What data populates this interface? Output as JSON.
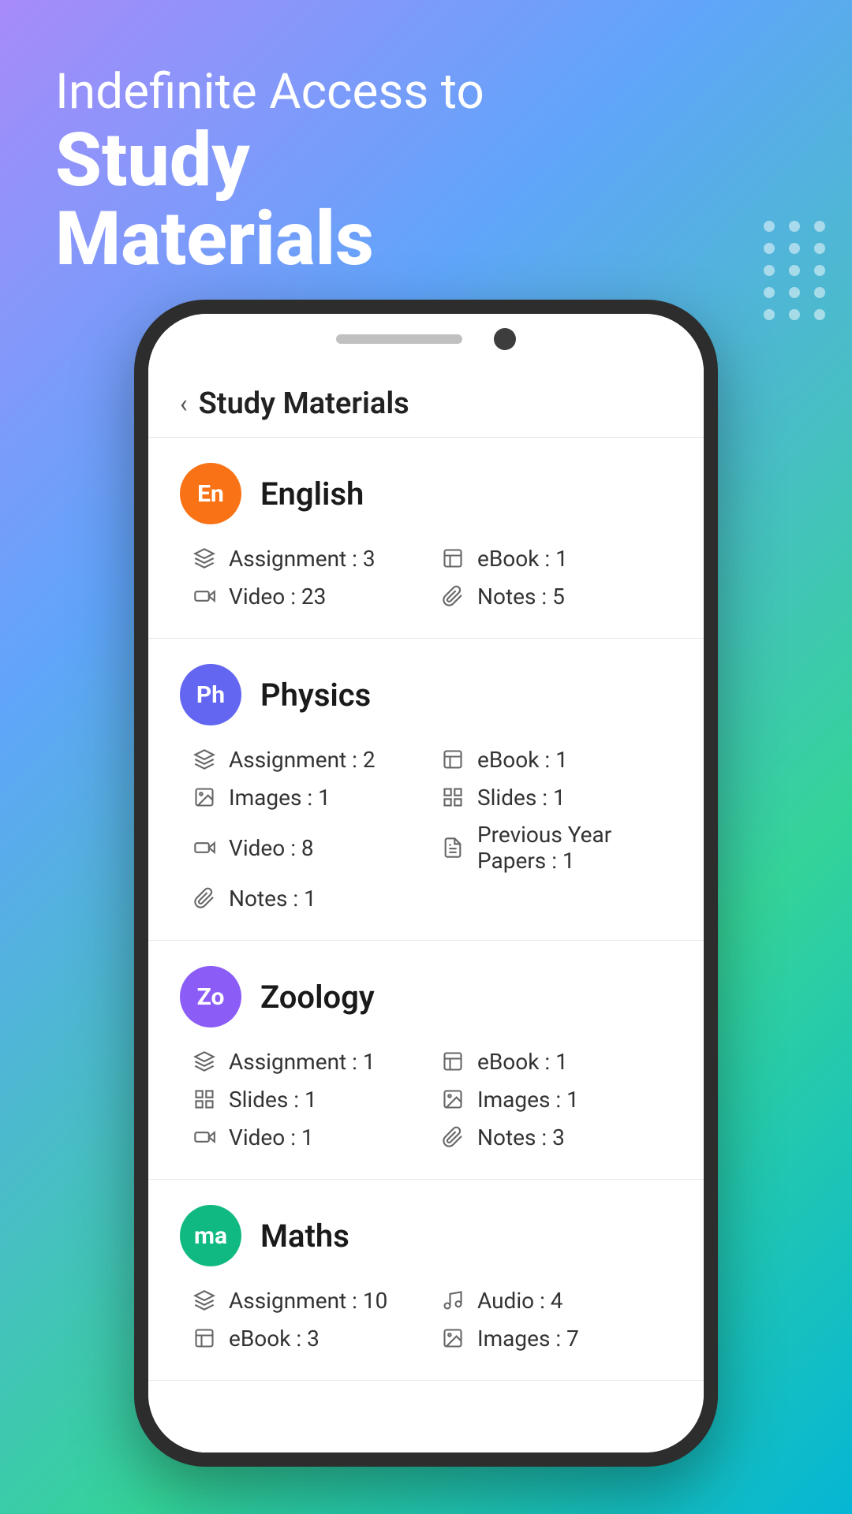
{
  "hero": {
    "line1": "Indefinite Access to",
    "line2": "Study\nMaterials"
  },
  "app": {
    "back_label": "‹",
    "title": "Study Materials"
  },
  "subjects": [
    {
      "id": "english",
      "avatar_text": "En",
      "avatar_class": "avatar-english",
      "name": "English",
      "stats": [
        {
          "icon": "layers",
          "label": "Assignment : 3"
        },
        {
          "icon": "book",
          "label": "eBook : 1"
        },
        {
          "icon": "video",
          "label": "Video : 23"
        },
        {
          "icon": "paperclip",
          "label": "Notes : 5"
        }
      ]
    },
    {
      "id": "physics",
      "avatar_text": "Ph",
      "avatar_class": "avatar-physics",
      "name": "Physics",
      "stats": [
        {
          "icon": "layers",
          "label": "Assignment : 2"
        },
        {
          "icon": "book",
          "label": "eBook : 1"
        },
        {
          "icon": "image",
          "label": "Images : 1"
        },
        {
          "icon": "grid",
          "label": "Slides : 1"
        },
        {
          "icon": "video",
          "label": "Video : 8"
        },
        {
          "icon": "file-text",
          "label": "Previous Year Papers : 1"
        },
        {
          "icon": "paperclip",
          "label": "Notes : 1"
        }
      ]
    },
    {
      "id": "zoology",
      "avatar_text": "Zo",
      "avatar_class": "avatar-zoology",
      "name": "Zoology",
      "stats": [
        {
          "icon": "layers",
          "label": "Assignment : 1"
        },
        {
          "icon": "book",
          "label": "eBook : 1"
        },
        {
          "icon": "grid",
          "label": "Slides : 1"
        },
        {
          "icon": "image",
          "label": "Images : 1"
        },
        {
          "icon": "video",
          "label": "Video : 1"
        },
        {
          "icon": "paperclip",
          "label": "Notes : 3"
        }
      ]
    },
    {
      "id": "maths",
      "avatar_text": "ma",
      "avatar_class": "avatar-maths",
      "name": "Maths",
      "stats": [
        {
          "icon": "layers",
          "label": "Assignment : 10"
        },
        {
          "icon": "music",
          "label": "Audio : 4"
        },
        {
          "icon": "book",
          "label": "eBook : 3"
        },
        {
          "icon": "image",
          "label": "Images : 7"
        }
      ]
    }
  ]
}
